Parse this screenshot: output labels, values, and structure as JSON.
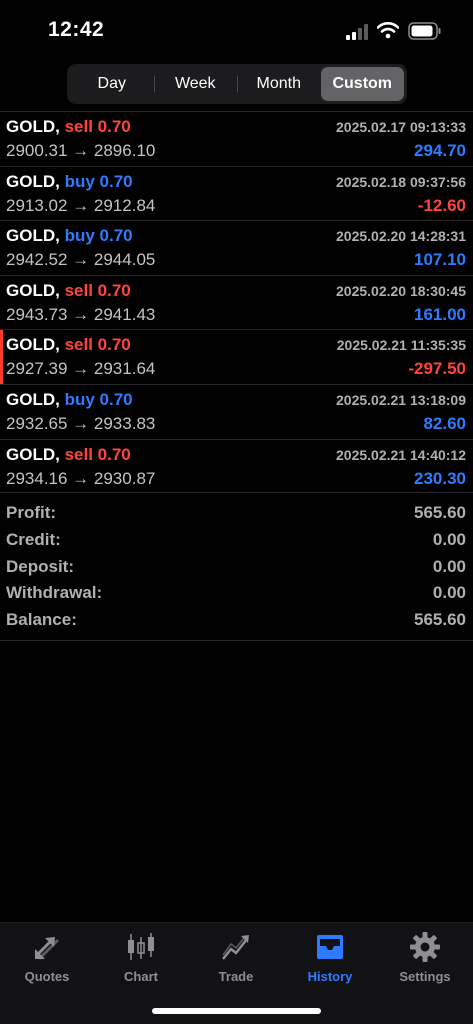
{
  "status": {
    "time": "12:42"
  },
  "periods": [
    "Day",
    "Week",
    "Month",
    "Custom"
  ],
  "active_period": "Custom",
  "trades": [
    {
      "symbol": "GOLD,",
      "side": "sell",
      "volume": "sell 0.70",
      "time": "2025.02.17 09:13:33",
      "prices": "2900.31 → 2896.10",
      "profit": "294.70"
    },
    {
      "symbol": "GOLD,",
      "side": "buy",
      "volume": "buy 0.70",
      "time": "2025.02.18 09:37:56",
      "prices": "2913.02 → 2912.84",
      "profit": "-12.60"
    },
    {
      "symbol": "GOLD,",
      "side": "buy",
      "volume": "buy 0.70",
      "time": "2025.02.20 14:28:31",
      "prices": "2942.52 → 2944.05",
      "profit": "107.10"
    },
    {
      "symbol": "GOLD,",
      "side": "sell",
      "volume": "sell 0.70",
      "time": "2025.02.20 18:30:45",
      "prices": "2943.73 → 2941.43",
      "profit": "161.00"
    },
    {
      "symbol": "GOLD,",
      "side": "sell",
      "volume": "sell 0.70",
      "time": "2025.02.21 11:35:35",
      "prices": "2927.39 → 2931.64",
      "profit": "-297.50"
    },
    {
      "symbol": "GOLD,",
      "side": "buy",
      "volume": "buy 0.70",
      "time": "2025.02.21 13:18:09",
      "prices": "2932.65 → 2933.83",
      "profit": "82.60"
    },
    {
      "symbol": "GOLD,",
      "side": "sell",
      "volume": "sell 0.70",
      "time": "2025.02.21 14:40:12",
      "prices": "2934.16 → 2930.87",
      "profit": "230.30"
    }
  ],
  "summary": [
    {
      "label": "Profit:",
      "value": "565.60"
    },
    {
      "label": "Credit:",
      "value": "0.00"
    },
    {
      "label": "Deposit:",
      "value": "0.00"
    },
    {
      "label": "Withdrawal:",
      "value": "0.00"
    },
    {
      "label": "Balance:",
      "value": "565.60"
    }
  ],
  "tabs": [
    {
      "label": "Quotes",
      "icon": "quotes-arrows-icon",
      "active": false
    },
    {
      "label": "Chart",
      "icon": "candlestick-chart-icon",
      "active": false
    },
    {
      "label": "Trade",
      "icon": "trade-trend-icon",
      "active": false
    },
    {
      "label": "History",
      "icon": "inbox-history-icon",
      "active": true
    },
    {
      "label": "Settings",
      "icon": "gear-icon",
      "active": false
    }
  ],
  "colors": {
    "sell": "#ff453a",
    "buy": "#2f7bff",
    "profit_positive": "#2f7bff",
    "profit_negative": "#ff453a",
    "active_tab": "#2f7bff",
    "inactive": "#8e8e93"
  }
}
